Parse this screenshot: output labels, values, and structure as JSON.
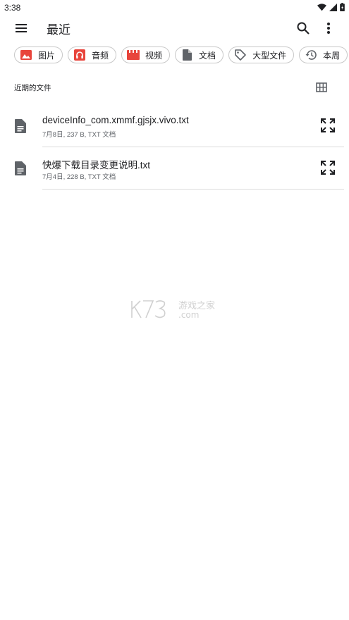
{
  "status": {
    "time": "3:38"
  },
  "app_bar": {
    "title": "最近"
  },
  "chips": [
    {
      "label": "图片",
      "icon": "image-icon",
      "color": "#e8453c"
    },
    {
      "label": "音频",
      "icon": "headphones-icon",
      "color": "#e8453c"
    },
    {
      "label": "视频",
      "icon": "video-clapper-icon",
      "color": "#e8453c"
    },
    {
      "label": "文档",
      "icon": "document-icon",
      "color": "#5f6368"
    },
    {
      "label": "大型文件",
      "icon": "tag-icon",
      "color": "#5f6368"
    },
    {
      "label": "本周",
      "icon": "history-icon",
      "color": "#5f6368"
    }
  ],
  "section": {
    "title": "近期的文件"
  },
  "files": [
    {
      "name": "deviceInfo_com.xmmf.gjsjx.vivo.txt",
      "meta": "7月8日, 237 B, TXT 文档"
    },
    {
      "name": "快爆下载目录变更说明.txt",
      "meta": "7月4日, 228 B, TXT 文档"
    }
  ],
  "watermark": {
    "text": "K73 游戏之家 .com"
  },
  "colors": {
    "accent": "#e8453c",
    "icon_gray": "#5f6368",
    "divider": "#dcdcdc"
  }
}
